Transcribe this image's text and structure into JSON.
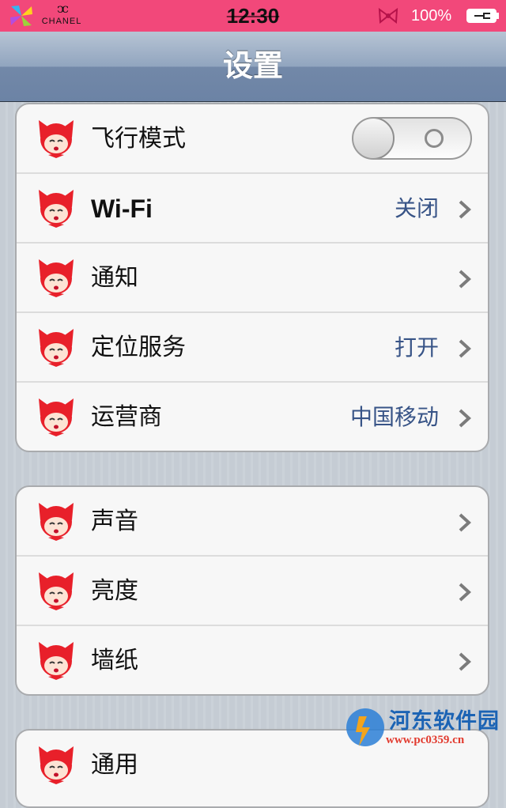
{
  "status_bar": {
    "brand": "CHANEL",
    "time": "12:30",
    "battery_percent": "100%",
    "background_color": "#f2487a"
  },
  "nav": {
    "title": "设置"
  },
  "groups": [
    {
      "rows": [
        {
          "label": "飞行模式",
          "icon": "fox-icon",
          "control": "toggle",
          "toggle_state": "off"
        },
        {
          "label": "Wi-Fi",
          "icon": "fox-icon",
          "value": "关闭"
        },
        {
          "label": "通知",
          "icon": "fox-icon"
        },
        {
          "label": "定位服务",
          "icon": "fox-icon",
          "value": "打开"
        },
        {
          "label": "运营商",
          "icon": "fox-icon",
          "value": "中国移动"
        }
      ]
    },
    {
      "rows": [
        {
          "label": "声音",
          "icon": "fox-icon"
        },
        {
          "label": "亮度",
          "icon": "fox-icon"
        },
        {
          "label": "墙纸",
          "icon": "fox-icon"
        }
      ]
    },
    {
      "rows": [
        {
          "label": "通用",
          "icon": "fox-icon"
        }
      ]
    }
  ],
  "watermark": {
    "name": "河东软件园",
    "url": "www.pc0359.cn"
  },
  "colors": {
    "value_text": "#385487",
    "nav_bar": "#7288a8"
  }
}
